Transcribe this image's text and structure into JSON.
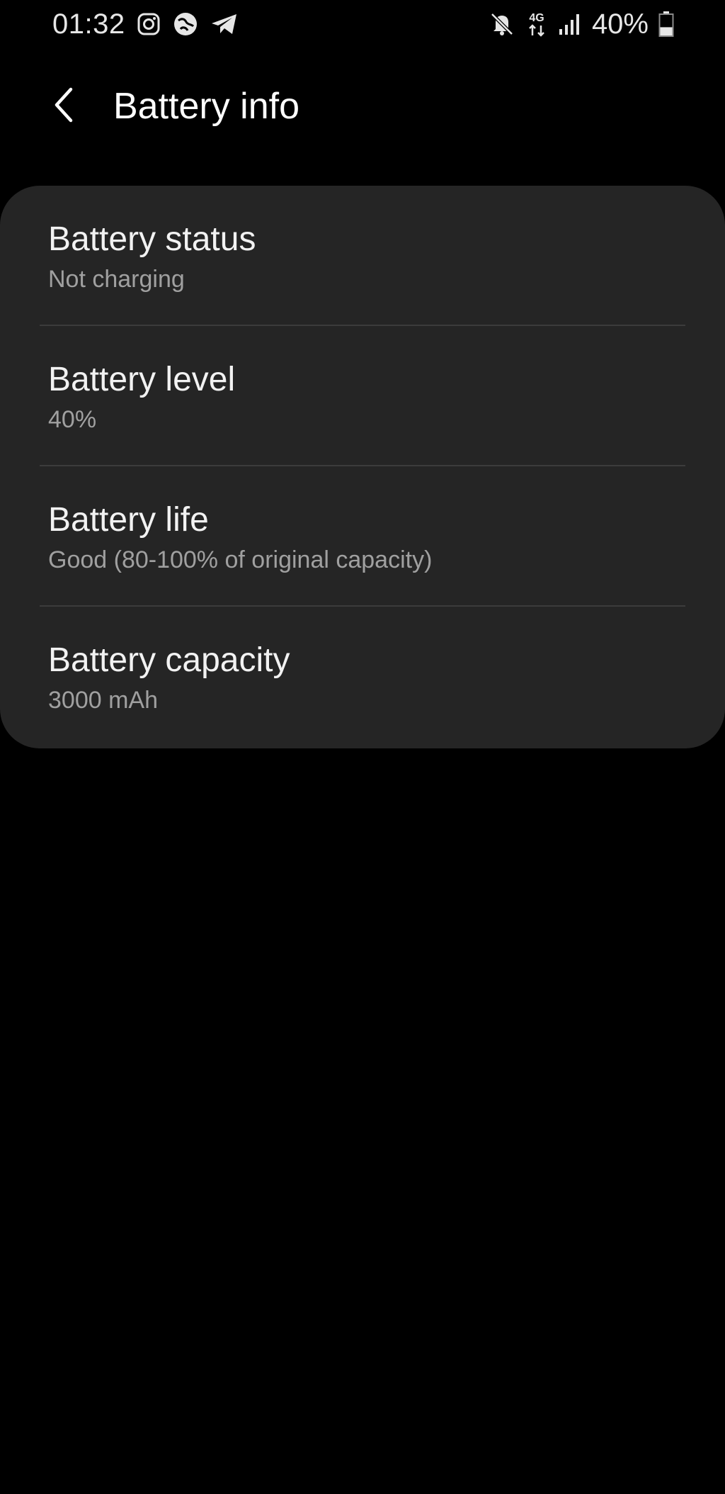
{
  "status_bar": {
    "time": "01:32",
    "left_icons": [
      "instagram-icon",
      "vpn-globe-icon",
      "telegram-icon"
    ],
    "right_icons": [
      "mute-icon",
      "4g-data-icon",
      "signal-icon"
    ],
    "network_label": "4G",
    "battery_percent_text": "40%",
    "battery_level": 0.4
  },
  "header": {
    "back_icon": "chevron-left-icon",
    "title": "Battery info"
  },
  "items": [
    {
      "title": "Battery status",
      "value": "Not charging"
    },
    {
      "title": "Battery level",
      "value": "40%"
    },
    {
      "title": "Battery life",
      "value": "Good (80-100% of original capacity)"
    },
    {
      "title": "Battery capacity",
      "value": "3000 mAh"
    }
  ],
  "colors": {
    "background": "#000000",
    "card": "#252525",
    "title_text": "#f2f2f2",
    "secondary_text": "#a0a0a0",
    "divider": "#3c3c3c"
  }
}
